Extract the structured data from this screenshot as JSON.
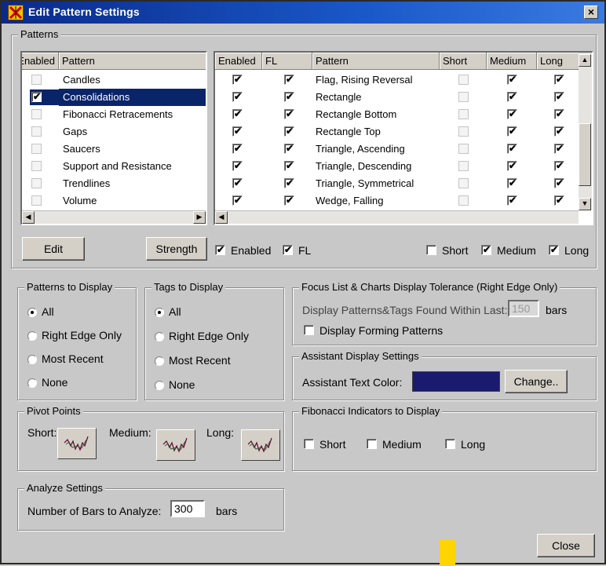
{
  "window": {
    "title": "Edit Pattern Settings",
    "close_glyph": "×"
  },
  "patterns_group": {
    "label": "Patterns"
  },
  "left_list": {
    "headers": {
      "enabled": "Enabled",
      "pattern": "Pattern"
    },
    "rows": [
      {
        "name": "Candles",
        "checked": false,
        "selected": false
      },
      {
        "name": "Consolidations",
        "checked": true,
        "selected": true
      },
      {
        "name": "Fibonacci Retracements",
        "checked": false,
        "selected": false
      },
      {
        "name": "Gaps",
        "checked": false,
        "selected": false
      },
      {
        "name": "Saucers",
        "checked": false,
        "selected": false
      },
      {
        "name": "Support and Resistance",
        "checked": false,
        "selected": false
      },
      {
        "name": "Trendlines",
        "checked": false,
        "selected": false
      },
      {
        "name": "Volume",
        "checked": false,
        "selected": false
      }
    ]
  },
  "right_list": {
    "headers": {
      "enabled": "Enabled",
      "fl": "FL",
      "pattern": "Pattern",
      "short": "Short",
      "medium": "Medium",
      "long": "Long"
    },
    "rows": [
      {
        "pattern": "Flag, Rising Reversal",
        "enabled": true,
        "fl": true,
        "short": false,
        "medium": true,
        "long": true
      },
      {
        "pattern": "Rectangle",
        "enabled": true,
        "fl": true,
        "short": false,
        "medium": true,
        "long": true
      },
      {
        "pattern": "Rectangle Bottom",
        "enabled": true,
        "fl": true,
        "short": false,
        "medium": true,
        "long": true
      },
      {
        "pattern": "Rectangle Top",
        "enabled": true,
        "fl": true,
        "short": false,
        "medium": true,
        "long": true
      },
      {
        "pattern": "Triangle, Ascending",
        "enabled": true,
        "fl": true,
        "short": false,
        "medium": true,
        "long": true
      },
      {
        "pattern": "Triangle, Descending",
        "enabled": true,
        "fl": true,
        "short": false,
        "medium": true,
        "long": true
      },
      {
        "pattern": "Triangle, Symmetrical",
        "enabled": true,
        "fl": true,
        "short": false,
        "medium": true,
        "long": true
      },
      {
        "pattern": "Wedge, Falling",
        "enabled": true,
        "fl": true,
        "short": false,
        "medium": true,
        "long": true
      }
    ]
  },
  "buttons": {
    "edit": "Edit",
    "strength": "Strength",
    "change": "Change..",
    "close": "Close"
  },
  "toggles": {
    "enabled": {
      "label": "Enabled",
      "checked": true
    },
    "fl": {
      "label": "FL",
      "checked": true
    },
    "short": {
      "label": "Short",
      "checked": false
    },
    "medium": {
      "label": "Medium",
      "checked": true
    },
    "long": {
      "label": "Long",
      "checked": true
    }
  },
  "patterns_to_display": {
    "label": "Patterns to Display",
    "options": [
      "All",
      "Right Edge Only",
      "Most Recent",
      "None"
    ],
    "selected": "All"
  },
  "tags_to_display": {
    "label": "Tags to Display",
    "options": [
      "All",
      "Right Edge Only",
      "Most Recent",
      "None"
    ],
    "selected": "All"
  },
  "focus_list": {
    "label": "Focus List & Charts Display Tolerance (Right Edge Only)",
    "prompt": "Display Patterns&Tags Found Within Last:",
    "value": "150",
    "unit": "bars",
    "forming_label": "Display Forming Patterns",
    "forming_checked": false
  },
  "assistant": {
    "label": "Assistant Display Settings",
    "text_color_label": "Assistant Text Color:",
    "text_color": "#1a1a6e"
  },
  "pivot_points": {
    "label": "Pivot Points",
    "short": "Short:",
    "medium": "Medium:",
    "long": "Long:"
  },
  "fibonacci": {
    "label": "Fibonacci Indicators to Display",
    "short": "Short",
    "medium": "Medium",
    "long": "Long"
  },
  "analyze": {
    "label": "Analyze Settings",
    "prompt": "Number of Bars to Analyze:",
    "value": "300",
    "unit": "bars"
  },
  "icons": {
    "app": "app-icon",
    "pivot": "chart-wave-icon",
    "check": "✔"
  }
}
